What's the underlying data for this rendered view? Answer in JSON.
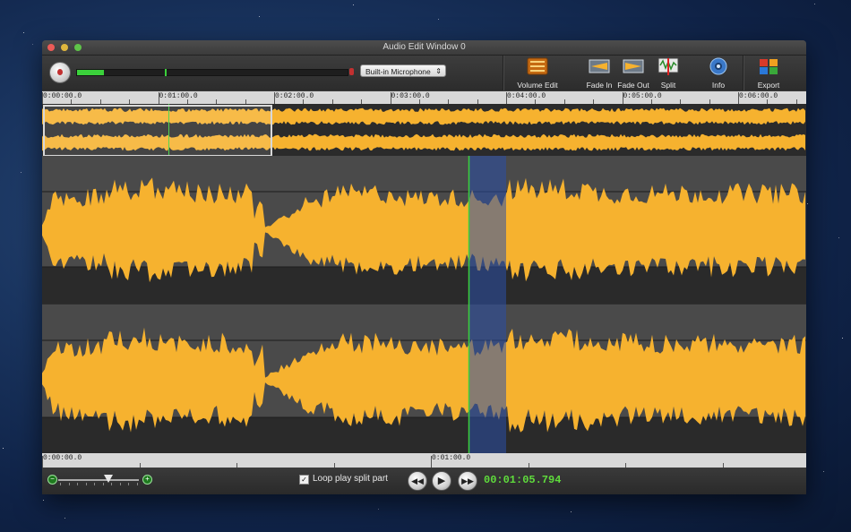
{
  "window": {
    "title": "Audio Edit Window 0"
  },
  "recorder": {
    "input_level_fraction": 0.1,
    "input_device": "Built-in Microphone"
  },
  "toolbar": {
    "tools": [
      {
        "label": "Volume Edit",
        "icon": "volume-edit-icon"
      },
      {
        "label": "Fade In",
        "icon": "fade-in-icon"
      },
      {
        "label": "Fade Out",
        "icon": "fade-out-icon"
      },
      {
        "label": "Split",
        "icon": "split-icon"
      },
      {
        "label": "Info",
        "icon": "info-icon"
      },
      {
        "label": "Export",
        "icon": "export-icon"
      }
    ]
  },
  "overview_ruler": {
    "labels": [
      "0:00:00.0",
      "0:01:00.0",
      "0:02:00.0",
      "0:03:00.0",
      "0:04:00.0",
      "0:05:00.0",
      "0:06:00.0"
    ]
  },
  "detail_ruler": {
    "labels": [
      "0:00:00.0",
      "0:01:00.0"
    ]
  },
  "transport": {
    "loop_label": "Loop play split part",
    "loop_checked": true,
    "time": "00:01:05.794"
  },
  "colors": {
    "waveform": "#f6b22f",
    "selection": "#2a4fa8",
    "playhead": "#3ad13a"
  }
}
